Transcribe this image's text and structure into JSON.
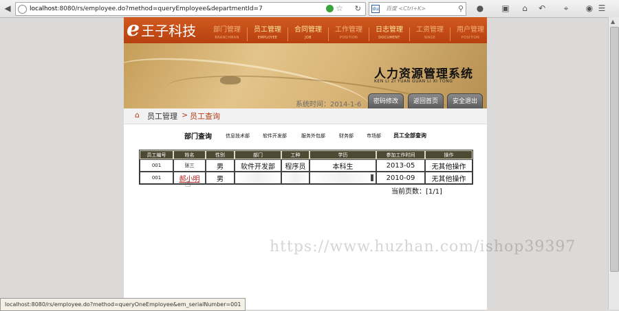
{
  "browser": {
    "url_host": "localhost",
    "url_rest": ":8080/rs/employee.do?method=queryEmployee&departmentId=7",
    "search_placeholder": "百度 <Ctrl+K>",
    "search_engine": "du"
  },
  "header": {
    "logo_letter": "e",
    "logo_name": "王子科技",
    "nav": [
      {
        "cn": "部门管理",
        "en": "BRANCHMAN"
      },
      {
        "cn": "员工管理",
        "en": "EMPLOYEE"
      },
      {
        "cn": "合同管理",
        "en": "JOB"
      },
      {
        "cn": "工作管理",
        "en": "POSITION"
      },
      {
        "cn": "日志管理",
        "en": "DOCUMENT"
      },
      {
        "cn": "工资管理",
        "en": "WAGE"
      },
      {
        "cn": "用户管理",
        "en": "POSITION"
      }
    ]
  },
  "banner": {
    "title": "人力资源管理系统",
    "subtitle": "KEN LI ZI YUAN GUAN LI XI TONG",
    "system_time": "系统时间：2014-1-6",
    "buttons": [
      "密码修改",
      "返回首页",
      "安全退出"
    ]
  },
  "breadcrumb": {
    "section": "员工管理",
    "separator": ">",
    "current": "员工查询"
  },
  "filter": {
    "title": "部门查询",
    "departments": [
      "信息技术部",
      "软件开发部",
      "服务外包部",
      "财务部",
      "市场部"
    ],
    "all_label": "员工全部查询"
  },
  "table": {
    "headers": [
      "员工编号",
      "姓名",
      "性别",
      "部门",
      "工种",
      "学历",
      "参加工作时间",
      "操作"
    ],
    "rows": [
      {
        "id": "001",
        "name": "张三",
        "gender": "男",
        "dept": "软件开发部",
        "job": "程序员",
        "edu": "本科生",
        "start": "2013-05",
        "op": "无其他操作"
      },
      {
        "id": "001",
        "name": "郝小明",
        "gender": "男",
        "dept": "",
        "job": "",
        "edu": "",
        "start": "2010-09",
        "op": "无其他操作"
      }
    ]
  },
  "pager": {
    "text": "当前页数：[1/1]"
  },
  "watermark": "https://www.huzhan.com/ishop39397",
  "status_url": "localhost:8080/rs/employee.do?method=queryOneEmployee&em_serialNumber=001",
  "colors": {
    "header_orange": "#c44c17",
    "table_header": "#4d4a34",
    "link_red": "#b31e1e"
  }
}
